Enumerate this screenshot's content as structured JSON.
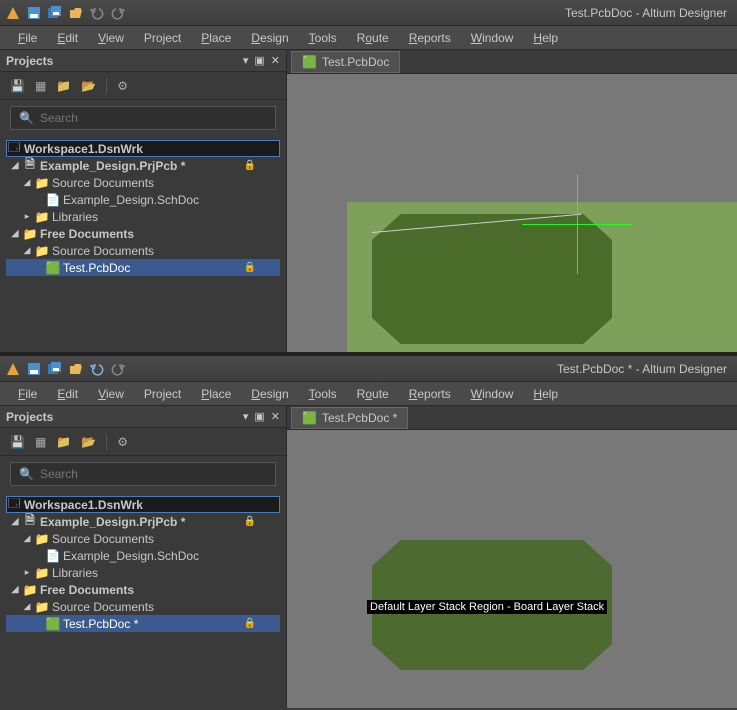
{
  "instances": [
    {
      "title": "Test.PcbDoc - Altium Designer",
      "tab_label": "Test.PcbDoc",
      "active_doc": "Test.PcbDoc",
      "has_crosshair": true,
      "has_label": false
    },
    {
      "title": "Test.PcbDoc * - Altium Designer",
      "tab_label": "Test.PcbDoc *",
      "active_doc": "Test.PcbDoc *",
      "has_crosshair": false,
      "has_label": true
    }
  ],
  "region_label": "Default Layer Stack Region - Board Layer Stack",
  "menu": [
    "File",
    "Edit",
    "View",
    "Project",
    "Place",
    "Design",
    "Tools",
    "Route",
    "Reports",
    "Window",
    "Help"
  ],
  "panel": {
    "title": "Projects",
    "search_placeholder": "Search"
  },
  "tree": {
    "workspace": "Workspace1.DsnWrk",
    "project": "Example_Design.PrjPcb *",
    "src_docs": "Source Documents",
    "schdoc": "Example_Design.SchDoc",
    "libraries": "Libraries",
    "free_docs": "Free Documents",
    "free_src": "Source Documents"
  }
}
